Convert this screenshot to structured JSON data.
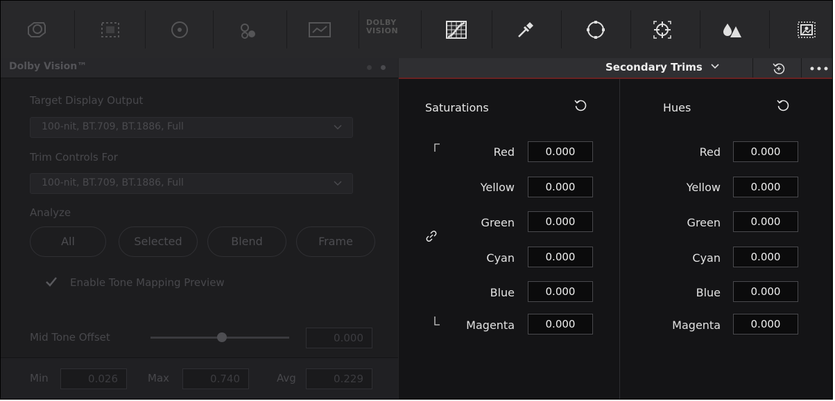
{
  "toolbar": {
    "dolby_logo_top": "DOLBY",
    "dolby_logo_bottom": "VISION"
  },
  "left_panel": {
    "title": "Dolby Vision™",
    "target_display_label": "Target Display Output",
    "target_display_value": "100-nit, BT.709, BT.1886, Full",
    "trim_controls_label": "Trim Controls For",
    "trim_controls_value": "100-nit, BT.709, BT.1886, Full",
    "analyze_label": "Analyze",
    "analyze_buttons": [
      "All",
      "Selected",
      "Blend",
      "Frame"
    ],
    "enable_tone_mapping_label": "Enable Tone Mapping Preview",
    "mid_tone_offset_label": "Mid Tone Offset",
    "mid_tone_offset_value": "0.000",
    "min_label": "Min",
    "min_value": "0.026",
    "max_label": "Max",
    "max_value": "0.740",
    "avg_label": "Avg",
    "avg_value": "0.229"
  },
  "right_panel": {
    "mode_title": "Secondary Trims",
    "saturations": {
      "title": "Saturations",
      "rows": [
        {
          "label": "Red",
          "value": "0.000"
        },
        {
          "label": "Yellow",
          "value": "0.000"
        },
        {
          "label": "Green",
          "value": "0.000"
        },
        {
          "label": "Cyan",
          "value": "0.000"
        },
        {
          "label": "Blue",
          "value": "0.000"
        },
        {
          "label": "Magenta",
          "value": "0.000"
        }
      ]
    },
    "hues": {
      "title": "Hues",
      "rows": [
        {
          "label": "Red",
          "value": "0.000"
        },
        {
          "label": "Yellow",
          "value": "0.000"
        },
        {
          "label": "Green",
          "value": "0.000"
        },
        {
          "label": "Cyan",
          "value": "0.000"
        },
        {
          "label": "Blue",
          "value": "0.000"
        },
        {
          "label": "Magenta",
          "value": "0.000"
        }
      ]
    }
  },
  "colors": {
    "accent_red": "#6b2222",
    "panel_bg": "#141416",
    "field_bg": "#0b0b0c"
  }
}
